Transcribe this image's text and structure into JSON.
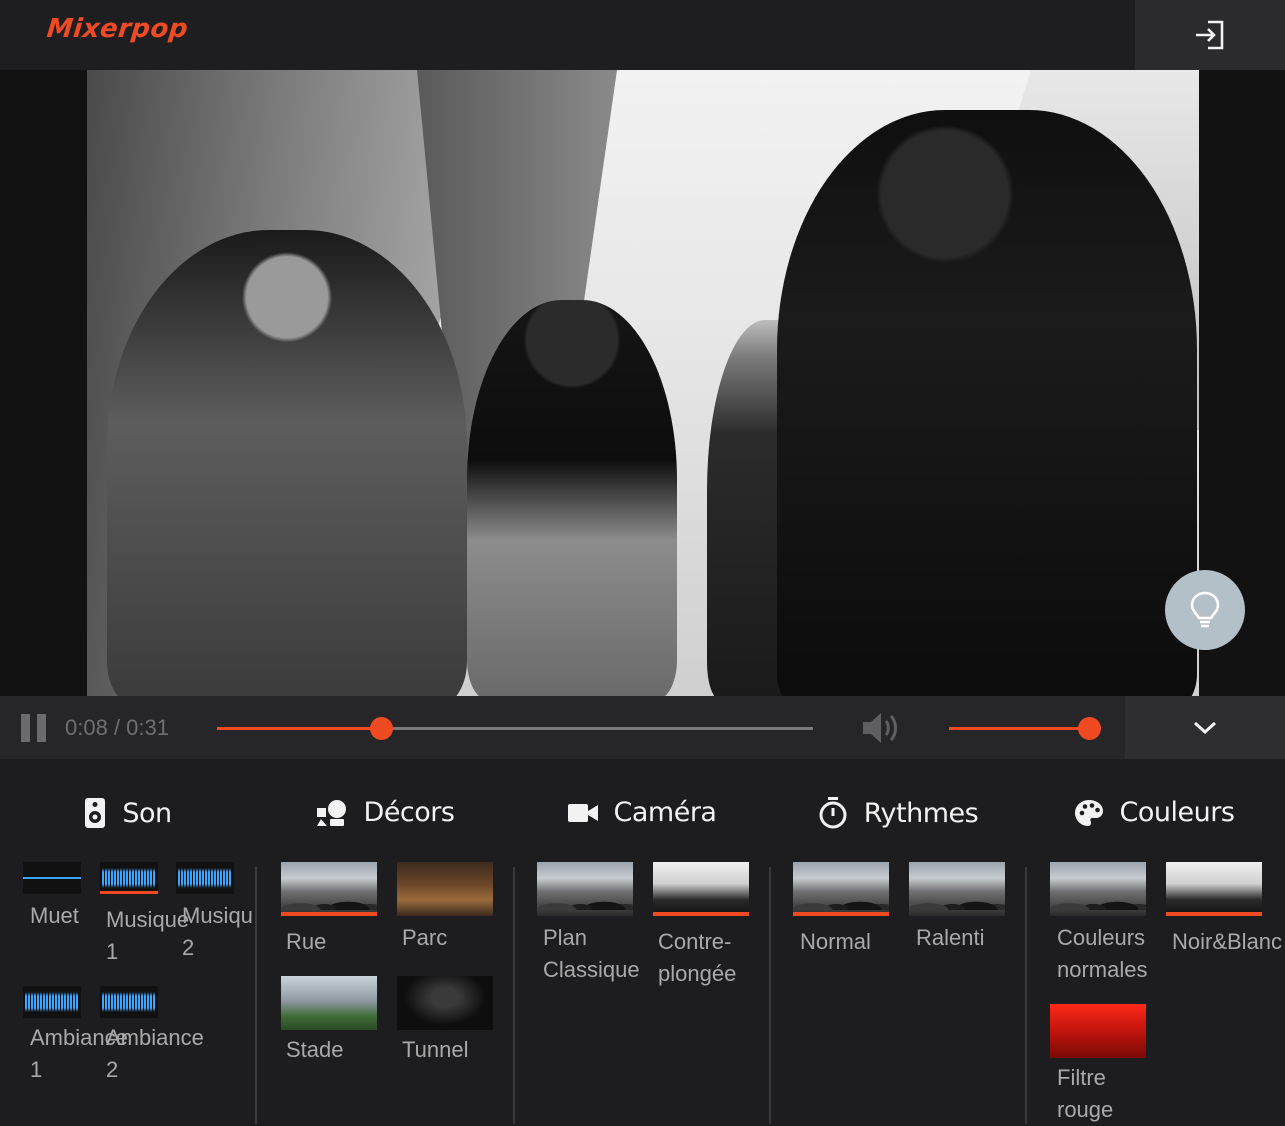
{
  "app": {
    "logo": "Mixerpop"
  },
  "player": {
    "time": "0:08 / 0:31",
    "progress_fraction": 0.275,
    "volume_fraction": 1.0,
    "accent_color": "#f04a23"
  },
  "panel": {
    "son": {
      "title": "Son",
      "items": [
        {
          "label": "Muet",
          "selected": false
        },
        {
          "label": "Musique\n1",
          "selected": true
        },
        {
          "label": "Musiqu\n2",
          "selected": false
        },
        {
          "label": "Ambiance\n1",
          "selected": false
        },
        {
          "label": "Ambiance\n2",
          "selected": false
        }
      ]
    },
    "decors": {
      "title": "Décors",
      "items": [
        {
          "label": "Rue",
          "selected": true
        },
        {
          "label": "Parc",
          "selected": false
        },
        {
          "label": "Stade",
          "selected": false
        },
        {
          "label": "Tunnel",
          "selected": false
        }
      ]
    },
    "camera": {
      "title": "Caméra",
      "items": [
        {
          "label": "Plan\nClassique",
          "selected": false
        },
        {
          "label": "Contre-\nplongée",
          "selected": true
        }
      ]
    },
    "rythmes": {
      "title": "Rythmes",
      "items": [
        {
          "label": "Normal",
          "selected": true
        },
        {
          "label": "Ralenti",
          "selected": false
        }
      ]
    },
    "couleurs": {
      "title": "Couleurs",
      "items": [
        {
          "label": "Couleurs\nnormales",
          "selected": false
        },
        {
          "label": "Noir&Blanc",
          "selected": true
        },
        {
          "label": "Filtre\nrouge",
          "selected": false
        }
      ]
    }
  }
}
